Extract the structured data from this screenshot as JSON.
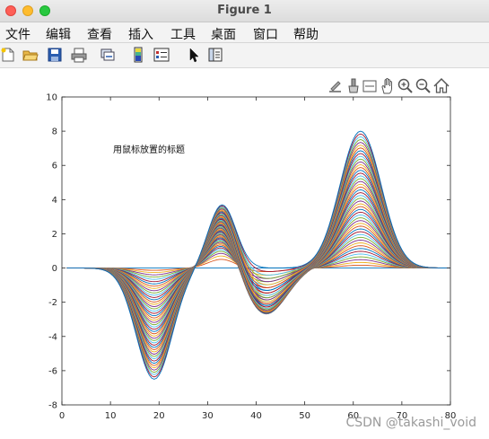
{
  "window": {
    "title": "Figure 1"
  },
  "menu": [
    "文件",
    "编辑",
    "查看",
    "插入",
    "工具",
    "桌面",
    "窗口",
    "帮助"
  ],
  "toolbar_icons": [
    "new-figure-icon",
    "open-file-icon",
    "save-icon",
    "print-icon",
    "link-icon",
    "colorbar-icon",
    "legend-icon",
    "pointer-icon",
    "property-inspector-icon"
  ],
  "axes_toolbar_icons": [
    "export-icon",
    "brush-icon",
    "data-tips-icon",
    "pan-icon",
    "zoom-in-icon",
    "zoom-out-icon",
    "home-icon"
  ],
  "plot": {
    "annotation": "用鼠标放置的标题"
  },
  "chart_data": {
    "type": "line",
    "xlim": [
      0,
      80
    ],
    "ylim": [
      -8,
      10
    ],
    "xticks": [
      0,
      10,
      20,
      30,
      40,
      50,
      60,
      70,
      80
    ],
    "yticks": [
      -8,
      -6,
      -4,
      -2,
      0,
      2,
      4,
      6,
      8,
      10
    ],
    "grid": false,
    "series_count": 50,
    "curve_components": [
      {
        "center": 19,
        "width": 5.2,
        "amplitude": -6.5
      },
      {
        "center": 33,
        "width": 4.0,
        "amplitude": 3.7
      },
      {
        "center": 42,
        "width": 6.0,
        "amplitude": -3.0
      },
      {
        "center": 61.5,
        "width": 6.0,
        "amplitude": 8.0
      }
    ],
    "x_range": [
      1,
      80
    ],
    "colors": [
      "#0072BD",
      "#D95319",
      "#EDB120",
      "#7E2F8E",
      "#77AC30",
      "#4DBEEE",
      "#A2142F"
    ]
  },
  "watermark": "CSDN @takashi_void"
}
